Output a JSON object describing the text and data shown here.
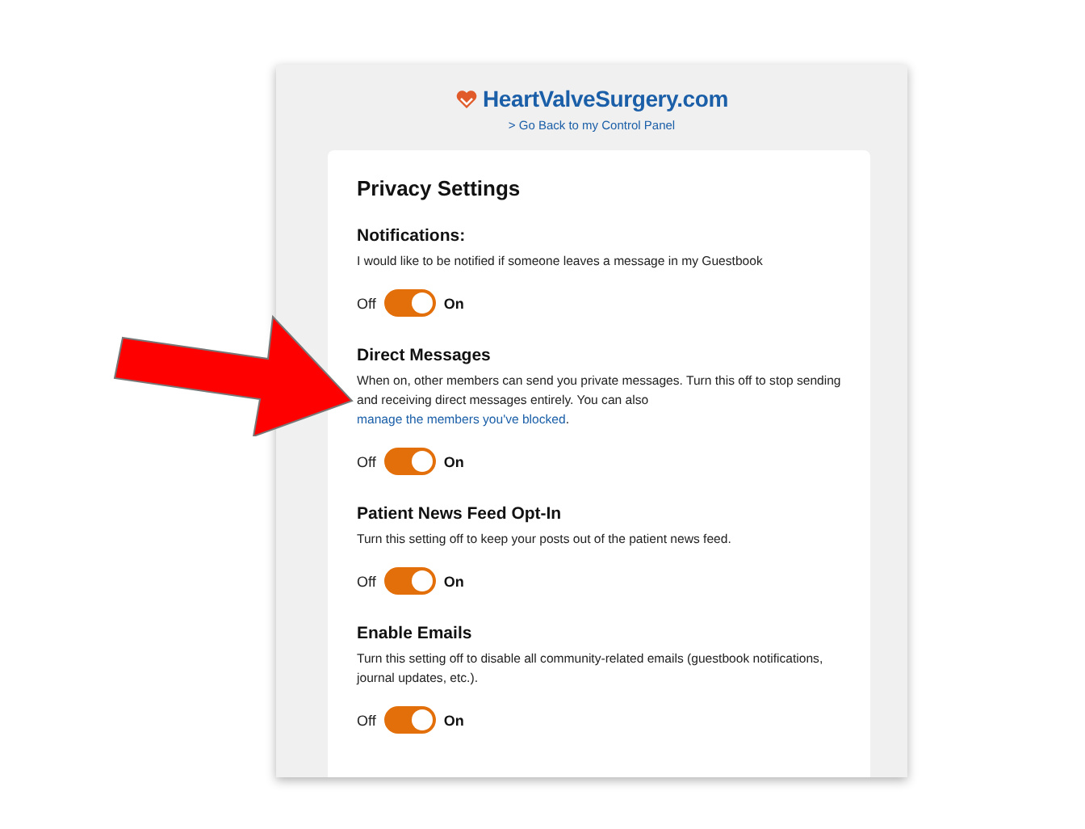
{
  "header": {
    "logo": "Heart**Valve**Surgery.com",
    "back_link": "> Go Back to my Control Panel"
  },
  "card": {
    "title": "Privacy Settings",
    "settings": [
      {
        "title": "Notifications:",
        "description": "I would like to be notified if someone leaves a message in my Guestbook",
        "toggle": {
          "off_label": "Off",
          "on_label": "On",
          "on": true
        }
      },
      {
        "title": "Direct Messages",
        "description": "When on, other members can send you private messages. Turn this off to stop sending and receiving direct messages entirely. You can also",
        "link": "manage the members you've blocked",
        "link_suffix": ".",
        "toggle": {
          "off_label": "Off",
          "on_label": "On",
          "on": true
        }
      },
      {
        "title": "Patient News Feed Opt-In",
        "description": "Turn this setting off to keep your posts out of the patient news feed.",
        "toggle": {
          "off_label": "Off",
          "on_label": "On",
          "on": true
        }
      },
      {
        "title": "Enable Emails",
        "description": "Turn this setting off to disable all community-related emails (guestbook notifications, journal updates, etc.).",
        "toggle": {
          "off_label": "Off",
          "on_label": "On",
          "on": true
        }
      }
    ]
  }
}
